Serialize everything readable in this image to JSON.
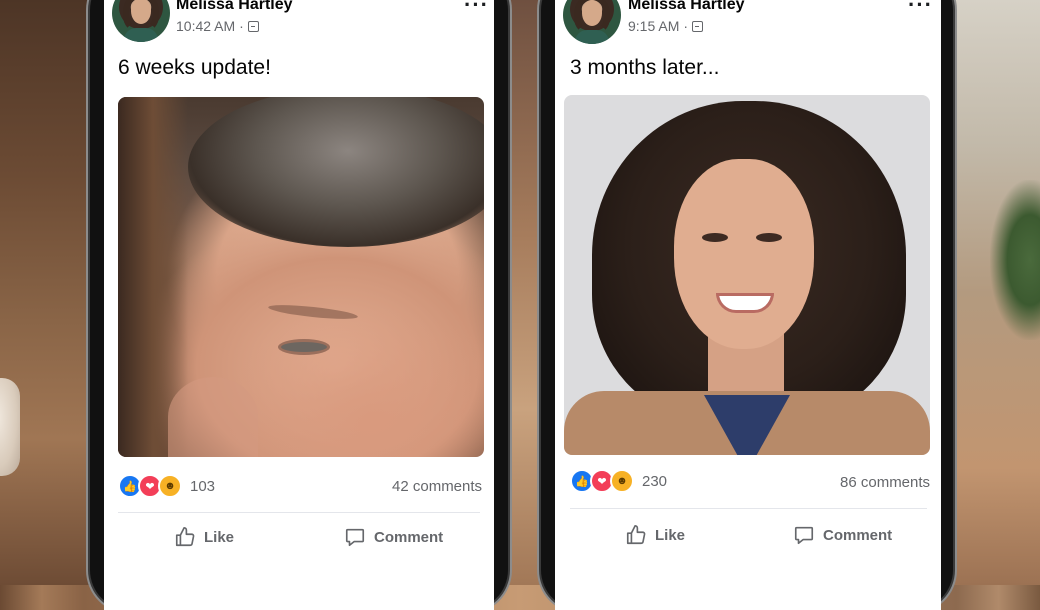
{
  "posts": [
    {
      "author": "Melissa Hartley",
      "time": "10:42 AM",
      "meta_separator": "·",
      "caption": "6 weeks update!",
      "reaction_icons": [
        "like-icon",
        "love-icon",
        "wow-icon"
      ],
      "reaction_count": "103",
      "comments": "42 comments",
      "actions": {
        "like": "Like",
        "comment": "Comment"
      }
    },
    {
      "author": "Melissa Hartley",
      "time": "9:15 AM",
      "meta_separator": "·",
      "caption": "3 months later...",
      "reaction_icons": [
        "like-icon",
        "love-icon",
        "wow-icon"
      ],
      "reaction_count": "230",
      "comments": "86 comments",
      "actions": {
        "like": "Like",
        "comment": "Comment"
      }
    }
  ],
  "colors": {
    "like": "#1877f2",
    "love": "#f33e58",
    "wow": "#f7b125",
    "text_primary": "#050505",
    "text_secondary": "#65676b"
  }
}
